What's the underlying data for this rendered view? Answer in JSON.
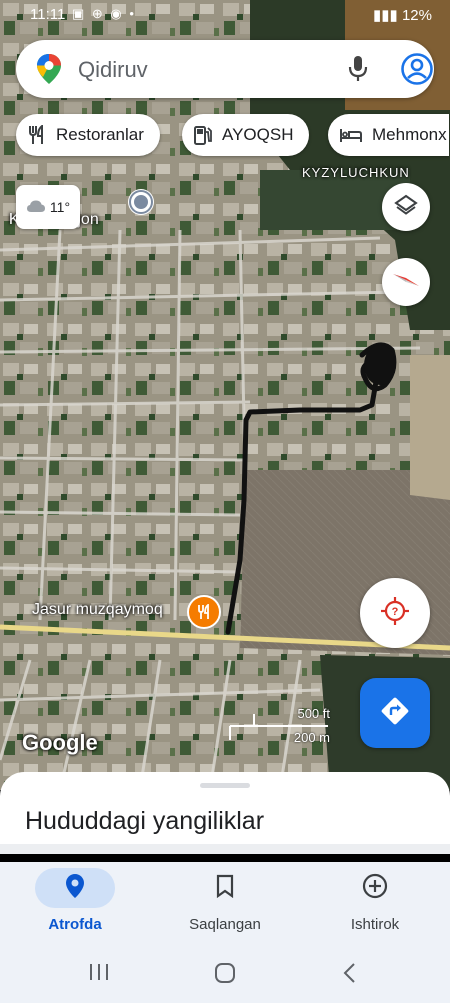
{
  "status_bar": {
    "time": "11:11",
    "icons": "▣ ⊕ ◉ •",
    "battery": "12%"
  },
  "search": {
    "placeholder": "Qidiruv"
  },
  "chips": [
    {
      "label": "Restoranlar",
      "icon": "fork-knife-icon"
    },
    {
      "label": "AYOQSH",
      "icon": "gas-station-icon"
    },
    {
      "label": "Mehmonx",
      "icon": "bed-icon"
    }
  ],
  "weather": {
    "temperature": "11°",
    "icon": "cloud-icon"
  },
  "map": {
    "place_label_top": "KYZYLUCHKUN",
    "place_label_left": "Ka       dajon",
    "poi_label": "Jasur muzqaymoq",
    "attribution": "Google",
    "scale_ft": "500 ft",
    "scale_m": "200 m"
  },
  "bottom_sheet": {
    "title": "Hududdagi yangiliklar"
  },
  "bottom_nav": [
    {
      "label": "Atrofda",
      "icon": "location-pin-icon",
      "active": true
    },
    {
      "label": "Saqlangan",
      "icon": "bookmark-icon",
      "active": false
    },
    {
      "label": "Ishtirok",
      "icon": "add-circle-icon",
      "active": false
    }
  ],
  "colors": {
    "accent": "#1a73e8",
    "active_text": "#0b57d0",
    "active_pill": "#cfe0f7",
    "nav_bg": "#eef2f8"
  }
}
